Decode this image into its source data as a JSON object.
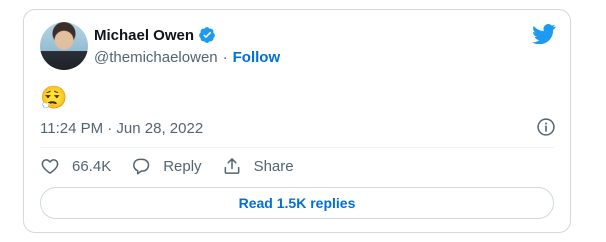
{
  "author": {
    "name": "Michael Owen",
    "handle": "@themichaelowen",
    "separator": "·",
    "follow_label": "Follow"
  },
  "tweet": {
    "text": "😮‍💨",
    "timestamp": "11:24 PM · Jun 28, 2022"
  },
  "actions": {
    "like_count": "66.4K",
    "reply_label": "Reply",
    "share_label": "Share"
  },
  "read_replies_label": "Read 1.5K replies",
  "colors": {
    "brand_blue": "#1d9bf0",
    "link_blue": "#006fd6",
    "secondary_text": "#536471",
    "border": "#cfd9de"
  },
  "icons": [
    "twitter-bird-icon",
    "verified-badge-icon",
    "info-icon",
    "heart-icon",
    "reply-icon",
    "share-icon"
  ]
}
